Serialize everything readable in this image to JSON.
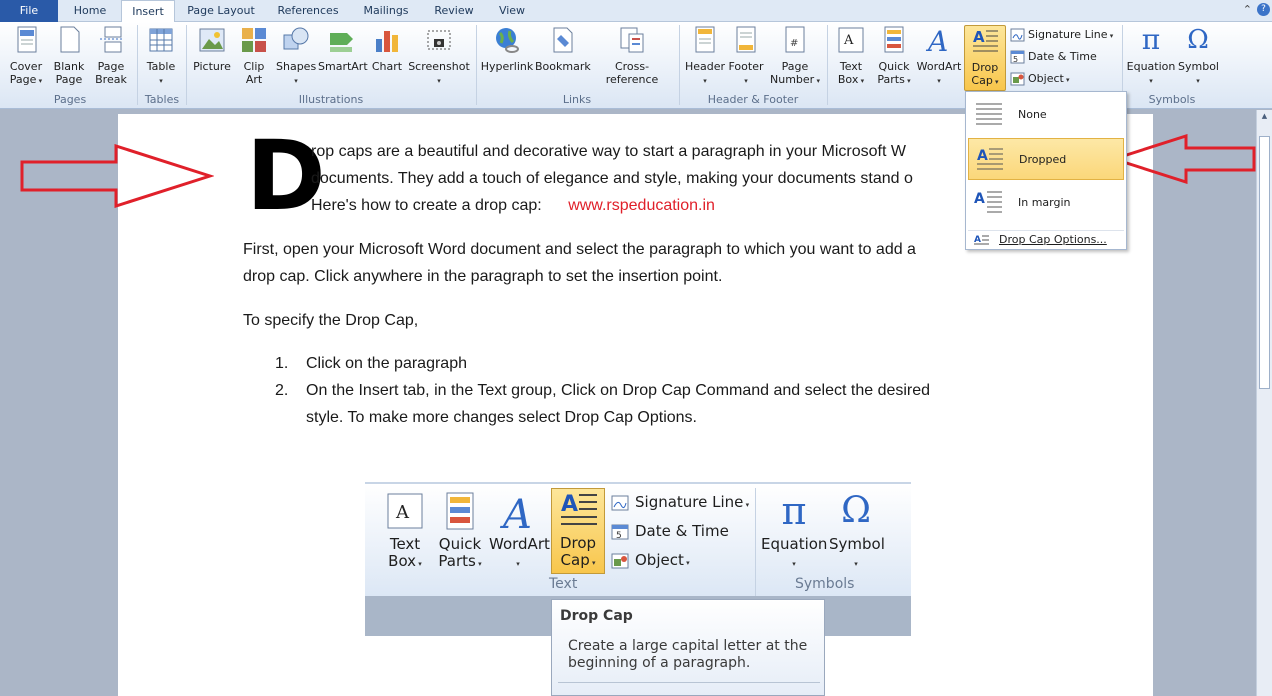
{
  "tabs": {
    "file": "File",
    "home": "Home",
    "insert": "Insert",
    "page_layout": "Page Layout",
    "references": "References",
    "mailings": "Mailings",
    "review": "Review",
    "view": "View"
  },
  "ribbon": {
    "pages": {
      "label": "Pages",
      "cover_page": "Cover Page",
      "blank_page": "Blank Page",
      "page_break": "Page Break"
    },
    "tables": {
      "label": "Tables",
      "table": "Table"
    },
    "illustrations": {
      "label": "Illustrations",
      "picture": "Picture",
      "clip_art": "Clip Art",
      "shapes": "Shapes",
      "smartart": "SmartArt",
      "chart": "Chart",
      "screenshot": "Screenshot"
    },
    "links": {
      "label": "Links",
      "hyperlink": "Hyperlink",
      "bookmark": "Bookmark",
      "cross_reference": "Cross-reference"
    },
    "header_footer": {
      "label": "Header & Footer",
      "header": "Header",
      "footer": "Footer",
      "page_number": "Page Number"
    },
    "text": {
      "text_box": "Text Box",
      "quick_parts": "Quick Parts",
      "wordart": "WordArt",
      "drop_cap": "Drop Cap",
      "signature_line": "Signature Line",
      "date_time": "Date & Time",
      "object": "Object"
    },
    "symbols": {
      "label": "Symbols",
      "equation": "Equation",
      "symbol": "Symbol"
    }
  },
  "dropdown": {
    "none": "None",
    "dropped": "Dropped",
    "in_margin": "In margin",
    "options": "Drop Cap Options..."
  },
  "document": {
    "drop_letter": "D",
    "intro_line1": "rop caps are a beautiful and decorative way to start a paragraph in your Microsoft W",
    "intro_line2": "documents. They add a touch of elegance and style, making your documents stand o",
    "intro_line3": "Here's how to create a drop cap:",
    "website": "www.rspeducation.in",
    "p2_line1": "First, open your Microsoft Word document and select the paragraph to which you want to add a",
    "p2_line2": "drop cap. Click anywhere in the paragraph to set the insertion point.",
    "p3": "To specify the Drop Cap,",
    "list": [
      {
        "num": "1.",
        "line1": "Click on the paragraph",
        "line2": ""
      },
      {
        "num": "2.",
        "line1": "On the Insert tab, in the Text group, Click on Drop Cap Command and select the desired",
        "line2": "style. To make more changes select Drop Cap Options."
      }
    ]
  },
  "embedded": {
    "text_box": "Text Box",
    "quick_parts": "Quick Parts",
    "wordart": "WordArt",
    "drop_cap": "Drop Cap",
    "signature_line": "Signature Line",
    "date_time": "Date & Time",
    "object": "Object",
    "text_label": "Text",
    "equation": "Equation",
    "symbol": "Symbol",
    "symbols_label": "Symbols",
    "tooltip_title": "Drop Cap",
    "tooltip_body_1": "Create a large capital letter at the",
    "tooltip_body_2": "beginning of a paragraph."
  },
  "colors": {
    "arrow": "#e0202a",
    "link": "#e0202a",
    "highlight": "#f8c64c",
    "file_tab": "#2a5aa8"
  }
}
